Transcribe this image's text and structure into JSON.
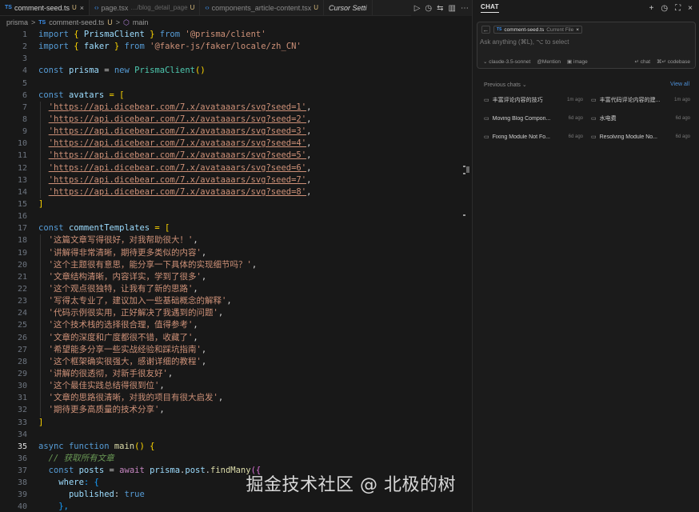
{
  "editor": {
    "tabs": [
      {
        "icon": "TS",
        "label": "comment-seed.ts",
        "badge": "U",
        "close": "×",
        "active": true
      },
      {
        "icon": "‹›",
        "label": "page.tsx",
        "desc": "…/blog_detail_page",
        "badge": "U",
        "active": false
      },
      {
        "icon": "‹›",
        "label": "components_article-content.tsx",
        "badge": "U",
        "active": false
      },
      {
        "icon": "",
        "label": "Cursor Setti",
        "active": false
      }
    ],
    "breadcrumb": [
      "prisma",
      ">",
      "TS",
      "comment-seed.ts",
      "U",
      ">",
      "main"
    ],
    "watermark": "掘金技术社区 @ 北极的树"
  },
  "code": {
    "imports": [
      {
        "ln": "1",
        "name": "PrismaClient",
        "from": "from",
        "src": "'@prisma/client'"
      },
      {
        "ln": "2",
        "name": "faker",
        "from": "from",
        "src": "'@faker-js/faker/locale/zh_CN'"
      }
    ],
    "prisma_line": {
      "ln": "4",
      "kw": "const",
      "name": "prisma",
      "new": "new",
      "cls": "PrismaClient",
      "tail": "()"
    },
    "avatars_open": {
      "ln": "6",
      "kw": "const",
      "name": "avatars",
      "tail": " = ["
    },
    "avatars": [
      {
        "ln": "7",
        "url": "'https://api.dicebear.com/7.x/avataaars/svg?seed=1'"
      },
      {
        "ln": "8",
        "url": "'https://api.dicebear.com/7.x/avataaars/svg?seed=2'"
      },
      {
        "ln": "9",
        "url": "'https://api.dicebear.com/7.x/avataaars/svg?seed=3'"
      },
      {
        "ln": "10",
        "url": "'https://api.dicebear.com/7.x/avataaars/svg?seed=4'"
      },
      {
        "ln": "11",
        "url": "'https://api.dicebear.com/7.x/avataaars/svg?seed=5'"
      },
      {
        "ln": "12",
        "url": "'https://api.dicebear.com/7.x/avataaars/svg?seed=6'"
      },
      {
        "ln": "13",
        "url": "'https://api.dicebear.com/7.x/avataaars/svg?seed=7'"
      },
      {
        "ln": "14",
        "url": "'https://api.dicebear.com/7.x/avataaars/svg?seed=8'"
      }
    ],
    "avatars_close": {
      "ln": "15",
      "text": "]"
    },
    "templates_open": {
      "ln": "17",
      "kw": "const",
      "name": "commentTemplates",
      "tail": " = ["
    },
    "templates": [
      {
        "ln": "18",
        "text": "'这篇文章写得很好，对我帮助很大！'"
      },
      {
        "ln": "19",
        "text": "'讲解得非常清晰，期待更多类似的内容'"
      },
      {
        "ln": "20",
        "text": "'这个主题很有意思，能分享一下具体的实现细节吗？'"
      },
      {
        "ln": "21",
        "text": "'文章结构清晰，内容详实，学到了很多'"
      },
      {
        "ln": "22",
        "text": "'这个观点很独特，让我有了新的思路'"
      },
      {
        "ln": "23",
        "text": "'写得太专业了，建议加入一些基础概念的解释'"
      },
      {
        "ln": "24",
        "text": "'代码示例很实用，正好解决了我遇到的问题'"
      },
      {
        "ln": "25",
        "text": "'这个技术栈的选择很合理，值得参考'"
      },
      {
        "ln": "26",
        "text": "'文章的深度和广度都很不错，收藏了'"
      },
      {
        "ln": "27",
        "text": "'希望能多分享一些实战经验和踩坑指南'"
      },
      {
        "ln": "28",
        "text": "'这个框架确实很强大，感谢详细的教程'"
      },
      {
        "ln": "29",
        "text": "'讲解的很透彻，对新手很友好'"
      },
      {
        "ln": "30",
        "text": "'这个最佳实践总结得很到位'"
      },
      {
        "ln": "31",
        "text": "'文章的思路很清晰，对我的项目有很大启发'"
      },
      {
        "ln": "32",
        "text": "'期待更多高质量的技术分享'"
      }
    ],
    "templates_close": {
      "ln": "33",
      "text": "]"
    },
    "main_line": {
      "ln": "35",
      "async": "async",
      "fn": "function",
      "name": "main",
      "tail": "() {"
    },
    "comment_line": {
      "ln": "36",
      "text": "// 获取所有文章"
    },
    "posts_line": {
      "ln": "37",
      "kw": "const",
      "name": "posts",
      "eq": " = ",
      "await": "await",
      "obj": "prisma",
      "prop": "post",
      "fn": "findMany",
      "tail": "({"
    },
    "where_line": {
      "ln": "38",
      "key": "where",
      "tail": ": {"
    },
    "published_line": {
      "ln": "39",
      "key": "published",
      "colon": ": ",
      "val": "true"
    },
    "close_line": {
      "ln": "40",
      "text": "},"
    }
  },
  "chat": {
    "title": "CHAT",
    "context_file": "comment-seed.ts",
    "context_file_icon": "TS",
    "context_sub": "Current File",
    "context_close": "×",
    "input_placeholder": "Ask anything (⌘L), ⌥ to select",
    "model": "claude-3.5-sonnet",
    "mention": "Mention",
    "image": "image",
    "chat_btn": "chat",
    "codebase_btn": "codebase",
    "previous_label": "Previous chats",
    "view_all": "View all",
    "history": [
      {
        "title": "丰富评论内容的技巧",
        "ago": "1m ago"
      },
      {
        "title": "丰富代码评论内容的建...",
        "ago": "1m ago"
      },
      {
        "title": "Moving Blog Compon...",
        "ago": "6d ago"
      },
      {
        "title": "水电费",
        "ago": "6d ago"
      },
      {
        "title": "Fixing Module Not Fo...",
        "ago": "6d ago"
      },
      {
        "title": "Resolving Module No...",
        "ago": "6d ago"
      }
    ]
  },
  "colors": {
    "editor_bg": "#181818",
    "string": "#ce9178",
    "keyword": "#569cd6",
    "variable": "#9cdcfe",
    "class": "#4ec9b0",
    "function": "#dcdcaa",
    "link": "#4d8fd6"
  }
}
